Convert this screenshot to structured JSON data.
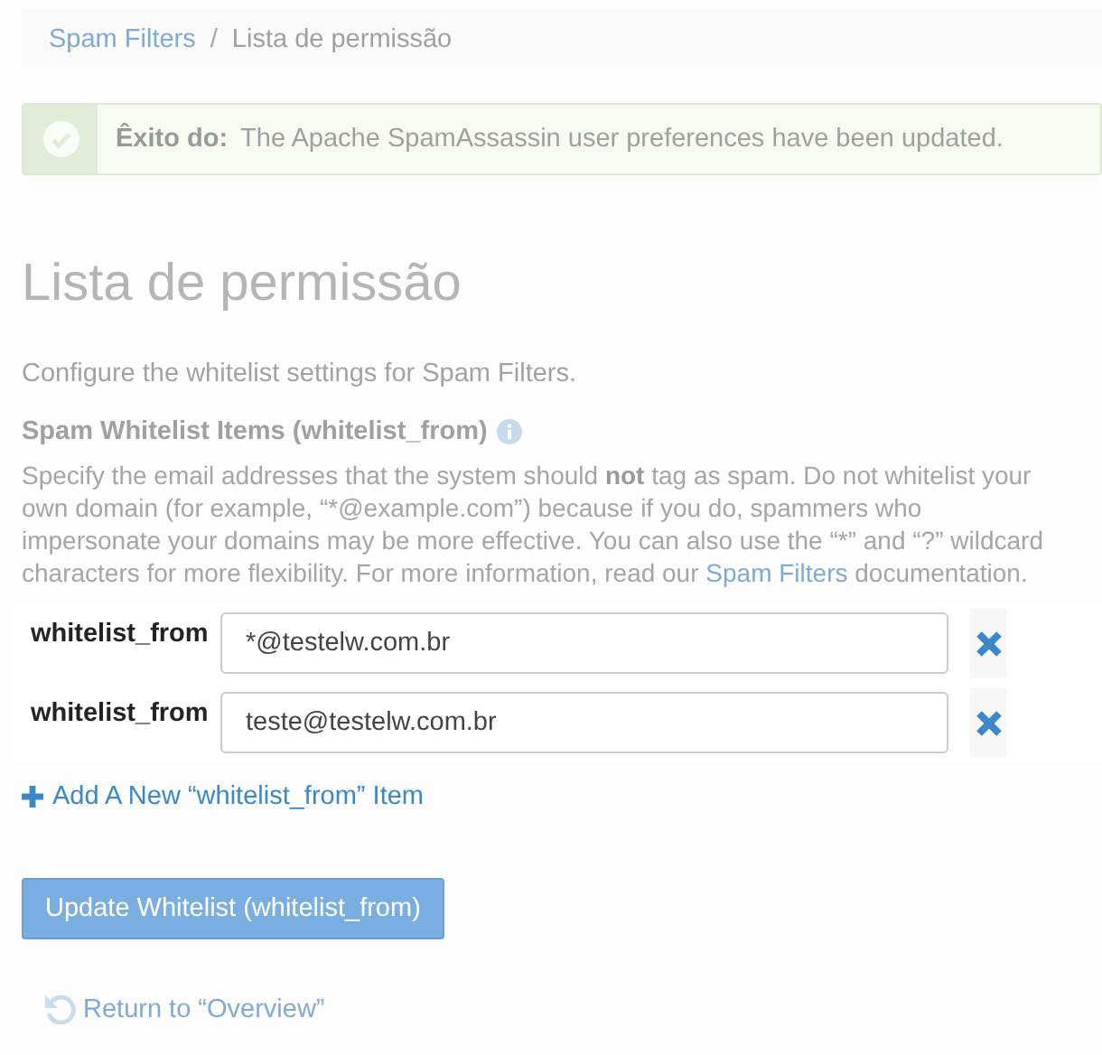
{
  "breadcrumb": [
    {
      "label": "Spam Filters",
      "kind": "link"
    },
    {
      "label": "Lista de permissão",
      "kind": "current"
    }
  ],
  "alert": {
    "kind": "success",
    "label": "Êxito do:",
    "message": "The Apache SpamAssassin user preferences have been updated."
  },
  "title": "Lista de permissão",
  "description": "Configure the whitelist settings for Spam Filters.",
  "breadcrumb_separator": "/",
  "section": {
    "heading": "Spam Whitelist Items (whitelist_from)",
    "help": [
      {
        "kind": "text",
        "text": "Specify the email addresses that the system should "
      },
      {
        "kind": "bold",
        "text": "not"
      },
      {
        "kind": "text",
        "text": " tag as spam. Do not whitelist your own domain (for example, “*@example.com”) because if you do, spammers who impersonate your domains may be more effective. You can also use the “*” and “?” wildcard characters for more flexibility. For more information, read our "
      },
      {
        "kind": "link",
        "text": "Spam Filters"
      },
      {
        "kind": "text",
        "text": " documentation."
      }
    ]
  },
  "items": [
    {
      "label": "whitelist_from",
      "value": "*@testelw.com.br"
    },
    {
      "label": "whitelist_from",
      "value": "teste@testelw.com.br"
    }
  ],
  "add_link": "Add A New “whitelist_from” Item",
  "submit_button": "Update Whitelist (whitelist_from)",
  "return_link": "Return to “Overview”"
}
